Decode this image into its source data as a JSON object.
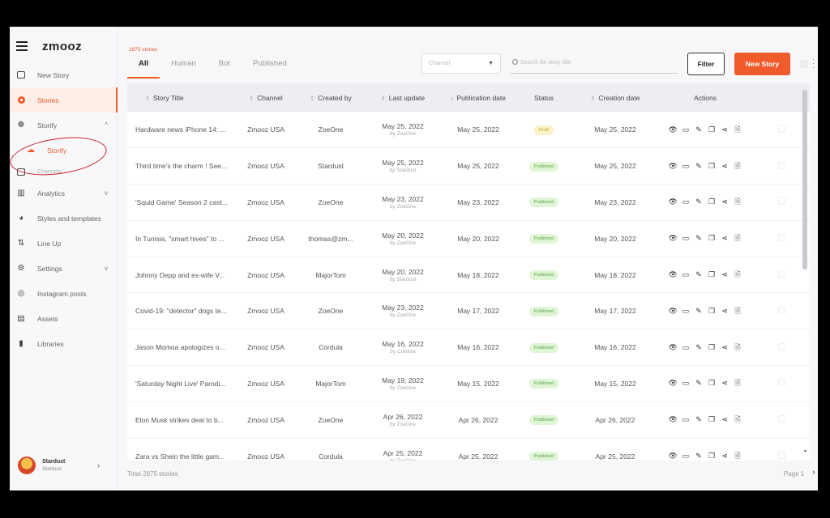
{
  "sidebar": {
    "logo": "zmooz",
    "items": [
      {
        "label": "New Story",
        "icon": "new-story-icon"
      },
      {
        "label": "Stories",
        "icon": "stories-icon",
        "active": true
      },
      {
        "label": "Storify",
        "icon": "storify-icon",
        "chevron": "^"
      },
      {
        "label": "Storify",
        "icon": "storify-sub-icon"
      },
      {
        "label": "Channels",
        "icon": "channels-icon"
      },
      {
        "label": "Analytics",
        "icon": "analytics-icon",
        "chevron": "v"
      },
      {
        "label": "Styles and templates",
        "icon": "palette-icon"
      },
      {
        "label": "Line Up",
        "icon": "lineup-icon"
      },
      {
        "label": "Settings",
        "icon": "gear-icon",
        "chevron": "v"
      },
      {
        "label": "Instagram posts",
        "icon": "instagram-icon"
      },
      {
        "label": "Assets",
        "icon": "assets-icon"
      },
      {
        "label": "Libraries",
        "icon": "libraries-icon"
      }
    ],
    "user": {
      "name": "Stardust",
      "sub": "Stardust"
    }
  },
  "header": {
    "count": "2875 stories",
    "tabs": [
      "All",
      "Human",
      "Bot",
      "Published"
    ],
    "channel_placeholder": "Channel",
    "search_placeholder": "Search for story title",
    "filter_label": "Filter",
    "new_story_label": "New Story"
  },
  "table": {
    "columns": [
      "Story Title",
      "Channel",
      "Created by",
      "Last update",
      "Publication date",
      "Status",
      "Creation date",
      "Actions"
    ],
    "rows": [
      {
        "title": "Hardware news iPhone 14: ...",
        "channel": "Zmooz USA",
        "created_by": "ZoeOne",
        "last_update": "May 25, 2022",
        "updated_by": "by ZoeOne",
        "publication": "May 25, 2022",
        "status": "Draft",
        "creation": "May 25, 2022"
      },
      {
        "title": "Third time's the charm ! See...",
        "channel": "Zmooz USA",
        "created_by": "Stardust",
        "last_update": "May 25, 2022",
        "updated_by": "by Stardust",
        "publication": "May 25, 2022",
        "status": "Published",
        "creation": "May 25, 2022"
      },
      {
        "title": "'Squid Game' Season 2 cast...",
        "channel": "Zmooz USA",
        "created_by": "ZoeOne",
        "last_update": "May 23, 2022",
        "updated_by": "by ZoeOne",
        "publication": "May 23, 2022",
        "status": "Published",
        "creation": "May 23, 2022"
      },
      {
        "title": "In Tunisia, \"smart hives\" to ...",
        "channel": "Zmooz USA",
        "created_by": "thomas@zm...",
        "last_update": "May 20, 2022",
        "updated_by": "by ZoeOne",
        "publication": "May 20, 2022",
        "status": "Published",
        "creation": "May 20, 2022"
      },
      {
        "title": "Johnny Depp and ex-wife V...",
        "channel": "Zmooz USA",
        "created_by": "MajorTom",
        "last_update": "May 20, 2022",
        "updated_by": "by Stardust",
        "publication": "May 18, 2022",
        "status": "Published",
        "creation": "May 18, 2022"
      },
      {
        "title": "Covid-19: \"detector\" dogs te...",
        "channel": "Zmooz USA",
        "created_by": "ZoeOne",
        "last_update": "May 23, 2022",
        "updated_by": "by ZoeOne",
        "publication": "May 17, 2022",
        "status": "Published",
        "creation": "May 17, 2022"
      },
      {
        "title": "Jason Momoa apologizes o...",
        "channel": "Zmooz USA",
        "created_by": "Cordula",
        "last_update": "May 16, 2022",
        "updated_by": "by Cordula",
        "publication": "May 16, 2022",
        "status": "Published",
        "creation": "May 16, 2022"
      },
      {
        "title": "'Saturday Night Live' Parodi...",
        "channel": "Zmooz USA",
        "created_by": "MajorTom",
        "last_update": "May 19, 2022",
        "updated_by": "by ZoeOne",
        "publication": "May 15, 2022",
        "status": "Published",
        "creation": "May 15, 2022"
      },
      {
        "title": "Elon Musk strikes deal to b...",
        "channel": "Zmooz USA",
        "created_by": "ZoeOne",
        "last_update": "Apr 26, 2022",
        "updated_by": "by ZoeOne",
        "publication": "Apr 26, 2022",
        "status": "Published",
        "creation": "Apr 26, 2022"
      },
      {
        "title": "Zara vs Shein the little gam...",
        "channel": "Zmooz USA",
        "created_by": "Cordula",
        "last_update": "Apr 25, 2022",
        "updated_by": "by ZoeOne",
        "publication": "Apr 25, 2022",
        "status": "Published",
        "creation": "Apr 25, 2022"
      }
    ]
  },
  "footer": {
    "total": "Total 2875 stories",
    "page": "Page 1"
  },
  "colors": {
    "accent": "#ef5b2b",
    "draft_bg": "#fdf2c6",
    "published_bg": "#dff5d6",
    "annotation": "#c8202a"
  }
}
